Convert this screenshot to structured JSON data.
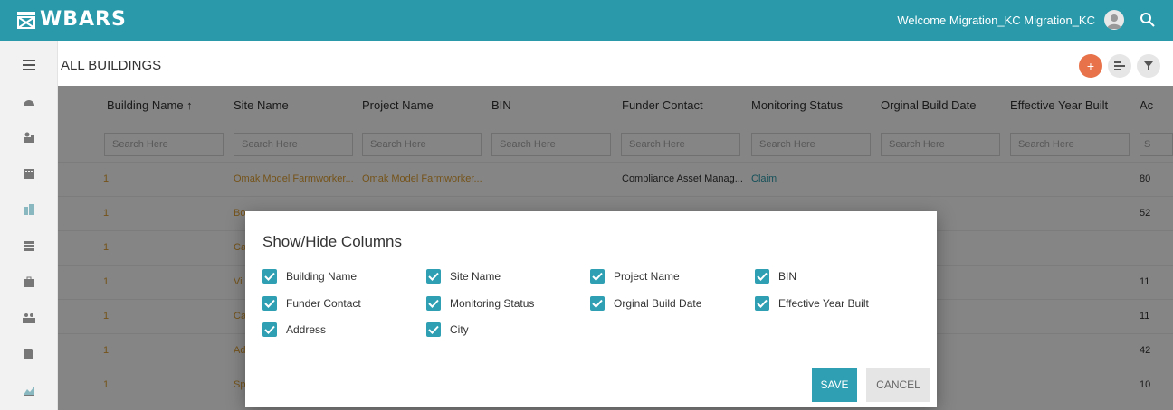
{
  "app": {
    "name": "WBARS",
    "welcome": "Welcome Migration_KC Migration_KC"
  },
  "page": {
    "title": "ALL BUILDINGS"
  },
  "table": {
    "columns": [
      "Building Name ↑",
      "Site Name",
      "Project Name",
      "BIN",
      "Funder Contact",
      "Monitoring Status",
      "Orginal Build Date",
      "Effective Year Built",
      "Ac"
    ],
    "search_placeholder": "Search Here",
    "rows": [
      {
        "building": "1",
        "site": "Omak Model Farmworker...",
        "project": "Omak Model Farmworker...",
        "funder": "Compliance Asset Manag...",
        "status": "Claim",
        "extra": "80"
      },
      {
        "building": "1",
        "site": "Bo",
        "project": "",
        "funder": "",
        "status": "",
        "extra": "52"
      },
      {
        "building": "1",
        "site": "Ca",
        "project": "",
        "funder": "",
        "status": "",
        "extra": ""
      },
      {
        "building": "1",
        "site": "Vi",
        "project": "",
        "funder": "",
        "status": "",
        "extra": "11"
      },
      {
        "building": "1",
        "site": "Ca",
        "project": "",
        "funder": "",
        "status": "",
        "extra": "11"
      },
      {
        "building": "1",
        "site": "Ad",
        "project": "",
        "funder": "",
        "status": "",
        "extra": "42"
      },
      {
        "building": "1",
        "site": "Sp",
        "project": "",
        "funder": "",
        "status": "",
        "extra": "10"
      }
    ]
  },
  "modal": {
    "title": "Show/Hide Columns",
    "options": [
      {
        "label": "Building Name",
        "checked": true
      },
      {
        "label": "Site Name",
        "checked": true
      },
      {
        "label": "Project Name",
        "checked": true
      },
      {
        "label": "BIN",
        "checked": true
      },
      {
        "label": "Funder Contact",
        "checked": true
      },
      {
        "label": "Monitoring Status",
        "checked": true
      },
      {
        "label": "Orginal Build Date",
        "checked": true
      },
      {
        "label": "Effective Year Built",
        "checked": true
      },
      {
        "label": "Address",
        "checked": true
      },
      {
        "label": "City",
        "checked": true
      }
    ],
    "save_label": "SAVE",
    "cancel_label": "CANCEL"
  },
  "sidebar": {
    "icons": [
      "menu-icon",
      "dashboard-icon",
      "users-icon",
      "building-icon",
      "buildings-icon",
      "stack-icon",
      "briefcase-icon",
      "group-icon",
      "document-icon",
      "chart-icon"
    ]
  },
  "colors": {
    "brand": "#2a9aab",
    "accent_orange": "#e8734a",
    "link_orange": "#e0a033"
  }
}
